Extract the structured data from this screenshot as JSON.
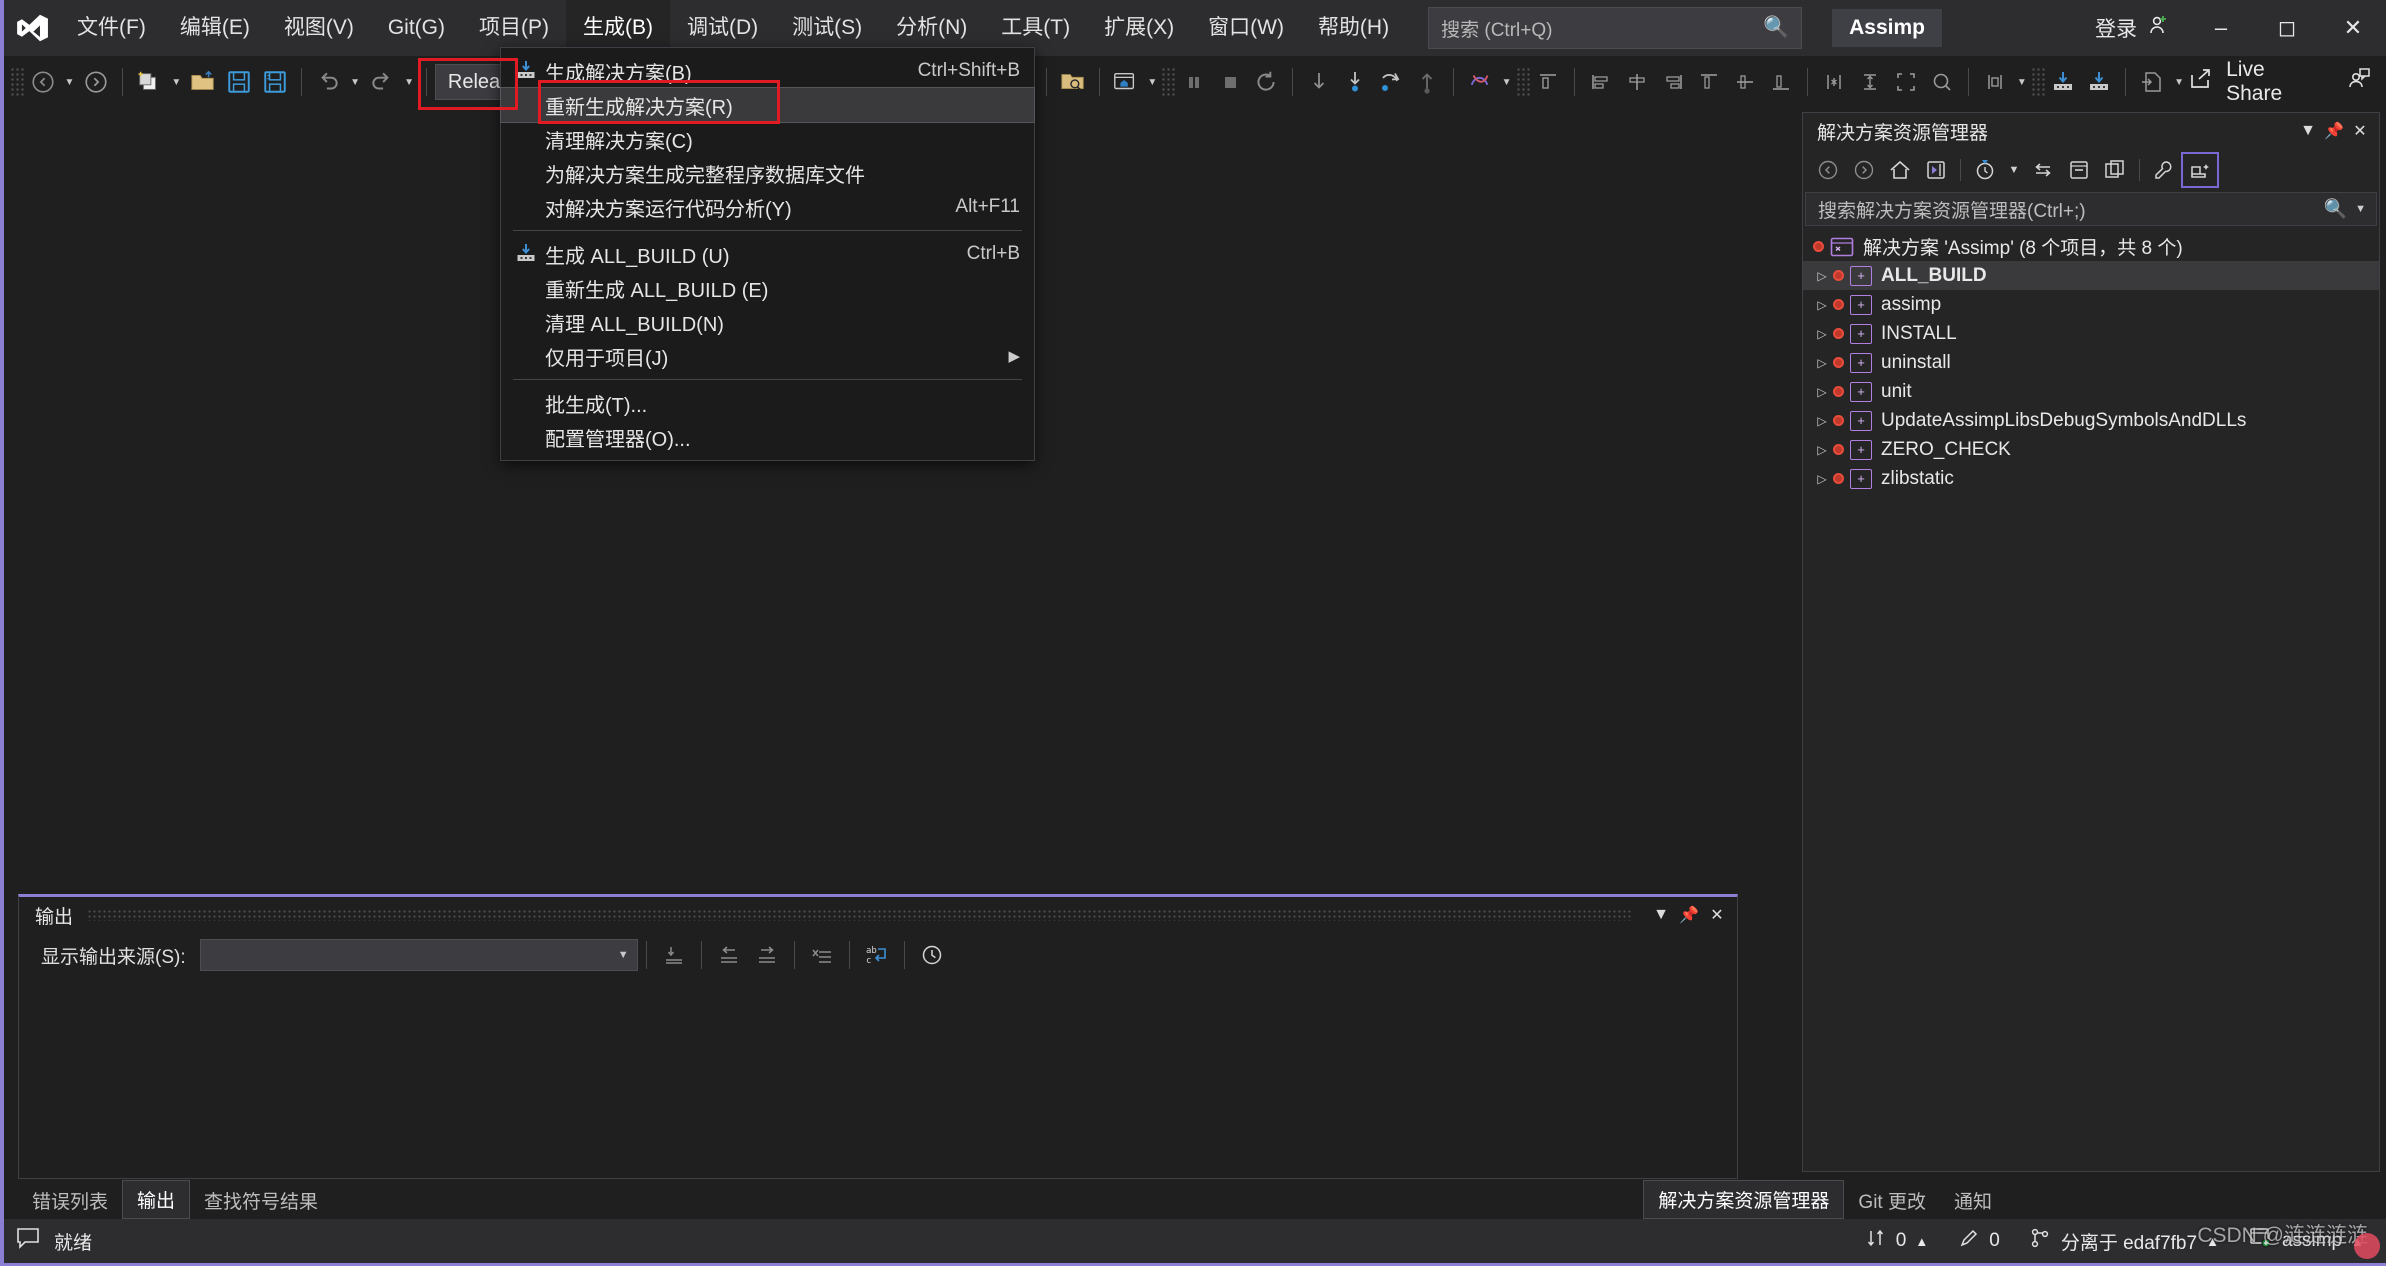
{
  "titlebar": {
    "logo_icon": "visual-studio-logo",
    "menus": [
      {
        "label": "文件(F)"
      },
      {
        "label": "编辑(E)"
      },
      {
        "label": "视图(V)"
      },
      {
        "label": "Git(G)"
      },
      {
        "label": "项目(P)"
      },
      {
        "label": "生成(B)"
      },
      {
        "label": "调试(D)"
      },
      {
        "label": "测试(S)"
      },
      {
        "label": "分析(N)"
      },
      {
        "label": "工具(T)"
      },
      {
        "label": "扩展(X)"
      },
      {
        "label": "窗口(W)"
      },
      {
        "label": "帮助(H)"
      }
    ],
    "active_menu": "生成(B)",
    "search_placeholder": "搜索 (Ctrl+Q)",
    "search_icon": "search-icon",
    "project_chip": "Assimp",
    "signin_label": "登录",
    "signin_icon": "add-user-icon",
    "minimize_icon": "minimize-icon",
    "maximize_icon": "maximize-icon",
    "close_icon": "close-icon"
  },
  "toolbar": {
    "configuration_value": "Release",
    "live_share_label": "Live Share",
    "live_share_icon": "share-icon",
    "invite_icon": "invite-people-icon"
  },
  "build_menu": {
    "items": [
      {
        "label": "生成解决方案(B)",
        "shortcut": "Ctrl+Shift+B",
        "icon": "build-icon",
        "selected": false,
        "separator_after": false
      },
      {
        "label": "重新生成解决方案(R)",
        "shortcut": "",
        "icon": "",
        "selected": true,
        "separator_after": false
      },
      {
        "label": "清理解决方案(C)",
        "shortcut": "",
        "icon": "",
        "selected": false,
        "separator_after": false
      },
      {
        "label": "为解决方案生成完整程序数据库文件",
        "shortcut": "",
        "icon": "",
        "selected": false,
        "separator_after": false
      },
      {
        "label": "对解决方案运行代码分析(Y)",
        "shortcut": "Alt+F11",
        "icon": "",
        "selected": false,
        "separator_after": true
      },
      {
        "label": "生成 ALL_BUILD (U)",
        "shortcut": "Ctrl+B",
        "icon": "build-icon",
        "selected": false,
        "separator_after": false
      },
      {
        "label": "重新生成 ALL_BUILD (E)",
        "shortcut": "",
        "icon": "",
        "selected": false,
        "separator_after": false
      },
      {
        "label": "清理 ALL_BUILD(N)",
        "shortcut": "",
        "icon": "",
        "selected": false,
        "separator_after": false
      },
      {
        "label": "仅用于项目(J)",
        "shortcut": "",
        "icon": "",
        "selected": false,
        "submenu": true,
        "separator_after": true
      },
      {
        "label": "批生成(T)...",
        "shortcut": "",
        "icon": "",
        "selected": false,
        "separator_after": false
      },
      {
        "label": "配置管理器(O)...",
        "shortcut": "",
        "icon": "",
        "selected": false,
        "separator_after": false
      }
    ]
  },
  "solution_explorer": {
    "title": "解决方案资源管理器",
    "header_buttons": [
      {
        "icon": "chevron-down-icon"
      },
      {
        "icon": "pin-icon"
      },
      {
        "icon": "close-icon"
      }
    ],
    "toolbar_icons": [
      "back-icon",
      "forward-icon",
      "home-icon",
      "switch-views-icon",
      "pending-changes-filter-icon",
      "chevron-down-icon",
      "sync-with-active-document-icon",
      "collapse-all-icon",
      "show-all-files-icon",
      "properties-icon",
      "preview-selected-items-icon"
    ],
    "search_placeholder": "搜索解决方案资源管理器(Ctrl+;)",
    "search_icon": "search-icon",
    "search_caret_icon": "chevron-down-icon",
    "root": {
      "label": "解决方案 'Assimp' (8 个项目，共 8 个)",
      "icon": "solution-icon",
      "status_icon": "pending-change-icon"
    },
    "projects": [
      {
        "label": "ALL_BUILD",
        "selected": true
      },
      {
        "label": "assimp",
        "selected": false
      },
      {
        "label": "INSTALL",
        "selected": false
      },
      {
        "label": "uninstall",
        "selected": false
      },
      {
        "label": "unit",
        "selected": false
      },
      {
        "label": "UpdateAssimpLibsDebugSymbolsAndDLLs",
        "selected": false
      },
      {
        "label": "ZERO_CHECK",
        "selected": false
      },
      {
        "label": "zlibstatic",
        "selected": false
      }
    ]
  },
  "output_panel": {
    "title": "输出",
    "header_buttons": [
      {
        "icon": "chevron-down-icon"
      },
      {
        "icon": "pin-icon"
      },
      {
        "icon": "close-icon"
      }
    ],
    "source_label": "显示输出来源(S):",
    "source_value": "",
    "toolbar_icons": [
      "go-to-message-icon",
      "previous-message-icon",
      "next-message-icon",
      "clear-all-icon",
      "toggle-word-wrap-icon",
      "show-output-history-icon"
    ],
    "content": ""
  },
  "bottom_tabs_left": [
    {
      "label": "错误列表",
      "active": false
    },
    {
      "label": "输出",
      "active": true
    },
    {
      "label": "查找符号结果",
      "active": false
    }
  ],
  "bottom_tabs_right": [
    {
      "label": "解决方案资源管理器",
      "active": true
    },
    {
      "label": "Git 更改",
      "active": false
    },
    {
      "label": "通知",
      "active": false
    }
  ],
  "statusbar": {
    "ready_label": "就绪",
    "ready_icon": "notification-icon",
    "sync_icon": "up-down-arrows-icon",
    "sync_count": "0",
    "sync_caret": "▲",
    "pencil_icon": "pencil-icon",
    "pencil_count": "0",
    "branch_icon": "branch-icon",
    "branch_label": "分离于 edaf7fb7",
    "branch_caret": "▲",
    "repo_icon": "repository-icon",
    "repo_label": "assimp",
    "repo_caret": "▲"
  },
  "watermark": {
    "text": "CSDN @涟涟涟涟"
  },
  "colors": {
    "accent_purple": "#8b7fd4",
    "annotation_red": "#e01b24",
    "titlebar_bg": "#2d2d30",
    "panel_bg": "#252526",
    "workspace_bg": "#1f1f1f",
    "selection_bg": "#3a3a3c"
  }
}
